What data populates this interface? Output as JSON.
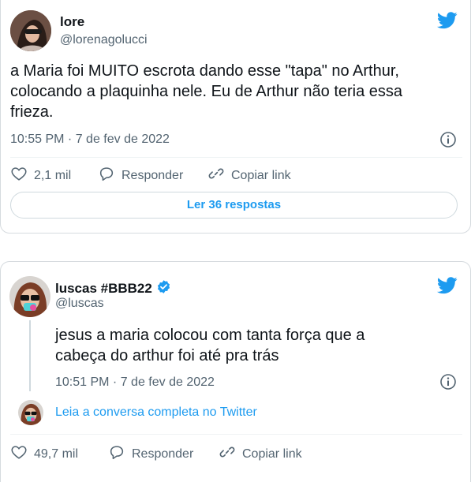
{
  "tweet1": {
    "name": "lore",
    "handle": "@lorenagolucci",
    "text_lines": [
      "a Maria foi MUITO escrota dando esse \"tapa\" no Arthur,",
      "colocando a plaquinha nele. Eu de Arthur não teria essa",
      "frieza."
    ],
    "timestamp": "10:55 PM · 7 de fev de 2022",
    "likes": "2,1 mil",
    "reply_label": "Responder",
    "copy_label": "Copiar link",
    "read_replies": "Ler 36 respostas"
  },
  "tweet2": {
    "name": "luscas #BBB22",
    "handle": "@luscas",
    "text_lines": [
      "jesus a maria colocou com tanta força que a",
      "cabeça do arthur foi até pra trás"
    ],
    "timestamp": "10:51 PM · 7 de fev de 2022",
    "thread_link": "Leia a conversa completa no Twitter",
    "likes": "49,7 mil",
    "reply_label": "Responder",
    "copy_label": "Copiar link"
  },
  "colors": {
    "twitter_blue": "#1d9bf0",
    "verified": "#1d9bf0",
    "muted": "#536471"
  },
  "icons": [
    "twitter-bird-icon",
    "info-icon",
    "heart-icon",
    "reply-bubble-icon",
    "link-icon",
    "verified-badge-icon"
  ]
}
